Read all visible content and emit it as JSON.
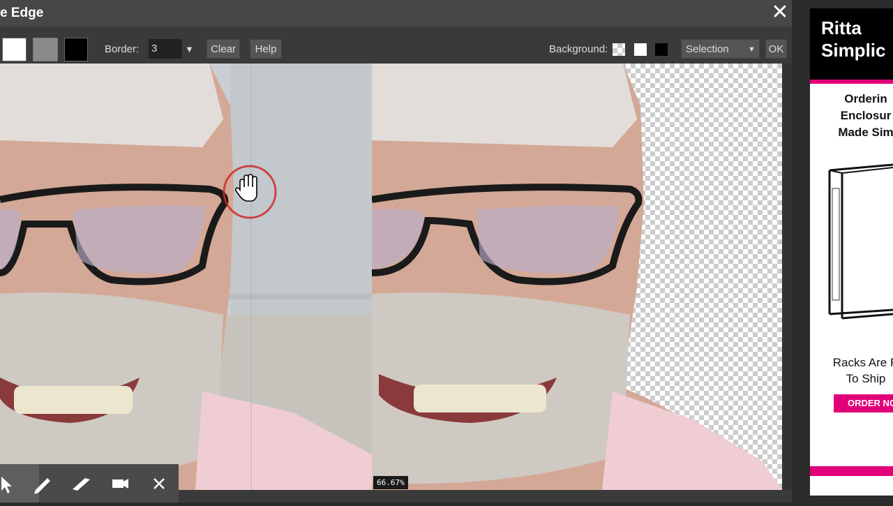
{
  "dialog": {
    "title": "e Edge",
    "close_glyph": "✕"
  },
  "toolbar": {
    "border_label": "Border:",
    "border_value": "3",
    "border_arrow": "▼",
    "clear_label": "Clear",
    "help_label": "Help",
    "background_label": "Background:",
    "selection_value": "Selection",
    "selection_arrow": "▼",
    "ok_label": "OK"
  },
  "canvas": {
    "zoom_level": "66.67%"
  },
  "bottom_tools": [
    {
      "name": "pointer-icon"
    },
    {
      "name": "pencil-icon"
    },
    {
      "name": "eraser-icon"
    },
    {
      "name": "camera-icon"
    },
    {
      "name": "close-icon"
    }
  ],
  "ad": {
    "brand_line1": "Ritta",
    "brand_line2": "Simplic",
    "headline_line1": "Orderin",
    "headline_line2": "Enclosur",
    "headline_line3": "Made Sim",
    "body_line1": "Racks Are R",
    "body_line2": "To Ship",
    "cta_label": "ORDER NO"
  },
  "colors": {
    "accent": "#e2007a",
    "cursor_ring": "#cc2a2a"
  }
}
